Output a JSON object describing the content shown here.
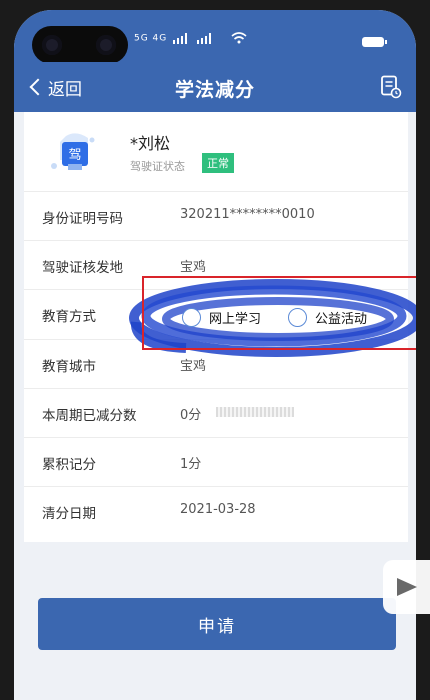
{
  "header": {
    "back_label": "返回",
    "title": "学法减分"
  },
  "status_bar": {
    "signal_text": "5G 4G"
  },
  "profile": {
    "name": "*刘松",
    "license_status_label": "驾驶证状态",
    "license_status_value": "正常",
    "badge_text": "驾"
  },
  "rows": [
    {
      "label": "身份证明号码",
      "value": "320211********0010"
    },
    {
      "label": "驾驶证核发地",
      "value": "宝鸡"
    },
    {
      "label": "教育方式",
      "value": ""
    },
    {
      "label": "教育城市",
      "value": "宝鸡"
    },
    {
      "label": "本周期已减分数",
      "value": "0分"
    },
    {
      "label": "累积记分",
      "value": "1分"
    },
    {
      "label": "清分日期",
      "value": "2021-03-28"
    }
  ],
  "education_options": [
    {
      "label": "网上学习",
      "selected": false
    },
    {
      "label": "公益活动",
      "selected": false
    }
  ],
  "apply_button_label": "申请",
  "colors": {
    "primary": "#3b67b0",
    "status_green": "#2fbf7e",
    "highlight_red": "#d9242a",
    "scribble_blue": "#1f43c9"
  },
  "icons": {
    "back": "chevron-left-icon",
    "document": "document-clock-icon",
    "license": "license-card-icon"
  }
}
